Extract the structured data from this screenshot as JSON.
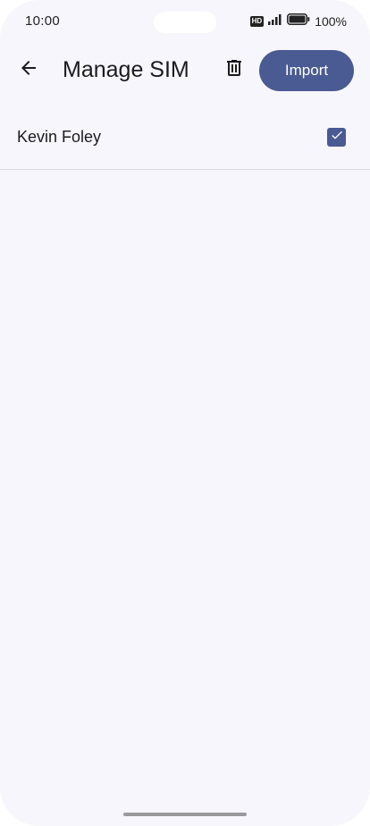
{
  "status_bar": {
    "time": "10:00",
    "hd_label": "HD",
    "battery_percent": "100%",
    "icons": [
      "hd-icon",
      "signal-icon",
      "battery-icon"
    ]
  },
  "app_bar": {
    "title": "Manage SIM",
    "back_icon": "arrow-back-icon",
    "delete_icon": "trash-icon",
    "import_label": "Import"
  },
  "contacts": [
    {
      "name": "Kevin Foley",
      "checked": true
    }
  ],
  "colors": {
    "background": "#f7f6fc",
    "accent": "#4a5a92",
    "text": "#1b1b1f",
    "divider": "#d9d8de"
  }
}
